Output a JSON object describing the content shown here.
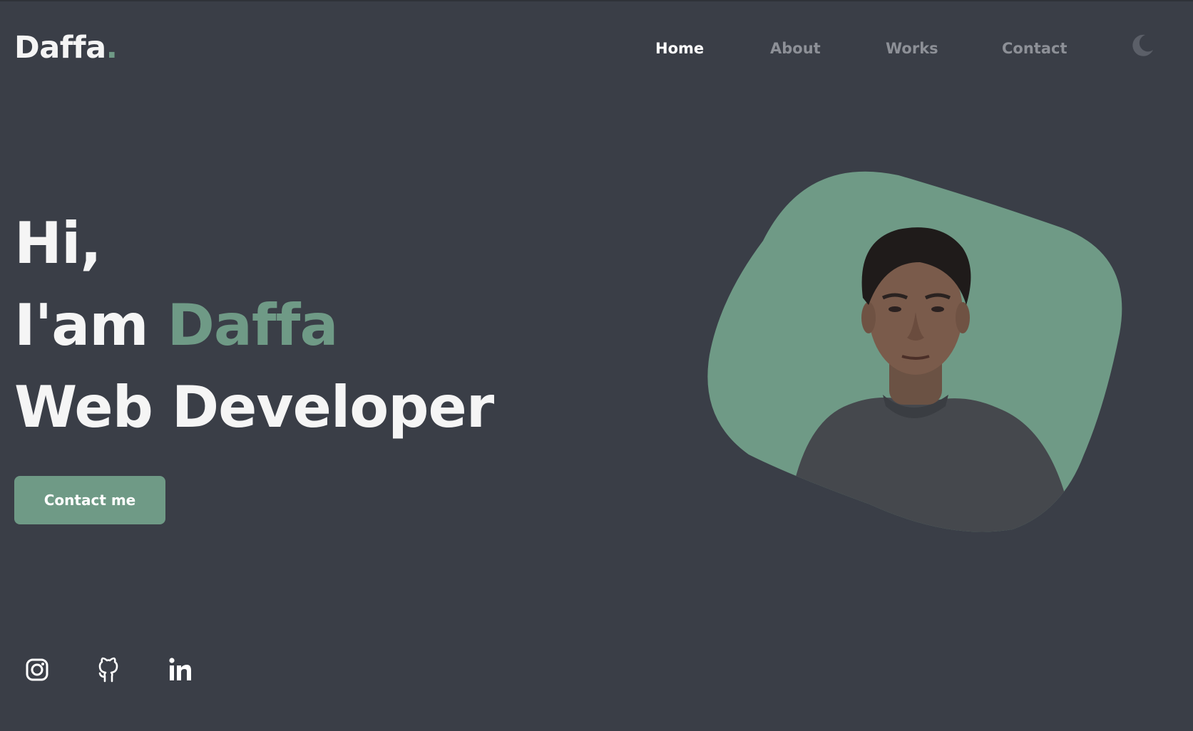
{
  "header": {
    "logo": "Daffa",
    "logo_dot": ".",
    "nav": {
      "home": "Home",
      "about": "About",
      "works": "Works",
      "contact": "Contact"
    },
    "theme_icon": "moon-icon"
  },
  "hero": {
    "greeting": "Hi,",
    "intro_prefix": "I'am",
    "intro_name": "Daffa",
    "role": "Web Developer",
    "cta_label": "Contact me"
  },
  "socials": {
    "icons": [
      "instagram-icon",
      "github-icon",
      "linkedin-icon"
    ]
  },
  "colors": {
    "background": "#3a3e47",
    "accent": "#6f9a86",
    "text": "#f5f5f5",
    "nav_muted": "#8d9097"
  }
}
